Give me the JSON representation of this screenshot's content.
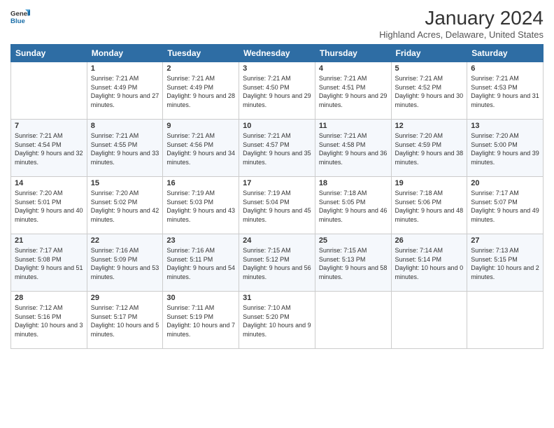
{
  "header": {
    "logo_line1": "General",
    "logo_line2": "Blue",
    "month_title": "January 2024",
    "location": "Highland Acres, Delaware, United States"
  },
  "weekdays": [
    "Sunday",
    "Monday",
    "Tuesday",
    "Wednesday",
    "Thursday",
    "Friday",
    "Saturday"
  ],
  "weeks": [
    [
      {
        "day": "",
        "sunrise": "",
        "sunset": "",
        "daylight": ""
      },
      {
        "day": "1",
        "sunrise": "Sunrise: 7:21 AM",
        "sunset": "Sunset: 4:49 PM",
        "daylight": "Daylight: 9 hours and 27 minutes."
      },
      {
        "day": "2",
        "sunrise": "Sunrise: 7:21 AM",
        "sunset": "Sunset: 4:49 PM",
        "daylight": "Daylight: 9 hours and 28 minutes."
      },
      {
        "day": "3",
        "sunrise": "Sunrise: 7:21 AM",
        "sunset": "Sunset: 4:50 PM",
        "daylight": "Daylight: 9 hours and 29 minutes."
      },
      {
        "day": "4",
        "sunrise": "Sunrise: 7:21 AM",
        "sunset": "Sunset: 4:51 PM",
        "daylight": "Daylight: 9 hours and 29 minutes."
      },
      {
        "day": "5",
        "sunrise": "Sunrise: 7:21 AM",
        "sunset": "Sunset: 4:52 PM",
        "daylight": "Daylight: 9 hours and 30 minutes."
      },
      {
        "day": "6",
        "sunrise": "Sunrise: 7:21 AM",
        "sunset": "Sunset: 4:53 PM",
        "daylight": "Daylight: 9 hours and 31 minutes."
      }
    ],
    [
      {
        "day": "7",
        "sunrise": "Sunrise: 7:21 AM",
        "sunset": "Sunset: 4:54 PM",
        "daylight": "Daylight: 9 hours and 32 minutes."
      },
      {
        "day": "8",
        "sunrise": "Sunrise: 7:21 AM",
        "sunset": "Sunset: 4:55 PM",
        "daylight": "Daylight: 9 hours and 33 minutes."
      },
      {
        "day": "9",
        "sunrise": "Sunrise: 7:21 AM",
        "sunset": "Sunset: 4:56 PM",
        "daylight": "Daylight: 9 hours and 34 minutes."
      },
      {
        "day": "10",
        "sunrise": "Sunrise: 7:21 AM",
        "sunset": "Sunset: 4:57 PM",
        "daylight": "Daylight: 9 hours and 35 minutes."
      },
      {
        "day": "11",
        "sunrise": "Sunrise: 7:21 AM",
        "sunset": "Sunset: 4:58 PM",
        "daylight": "Daylight: 9 hours and 36 minutes."
      },
      {
        "day": "12",
        "sunrise": "Sunrise: 7:20 AM",
        "sunset": "Sunset: 4:59 PM",
        "daylight": "Daylight: 9 hours and 38 minutes."
      },
      {
        "day": "13",
        "sunrise": "Sunrise: 7:20 AM",
        "sunset": "Sunset: 5:00 PM",
        "daylight": "Daylight: 9 hours and 39 minutes."
      }
    ],
    [
      {
        "day": "14",
        "sunrise": "Sunrise: 7:20 AM",
        "sunset": "Sunset: 5:01 PM",
        "daylight": "Daylight: 9 hours and 40 minutes."
      },
      {
        "day": "15",
        "sunrise": "Sunrise: 7:20 AM",
        "sunset": "Sunset: 5:02 PM",
        "daylight": "Daylight: 9 hours and 42 minutes."
      },
      {
        "day": "16",
        "sunrise": "Sunrise: 7:19 AM",
        "sunset": "Sunset: 5:03 PM",
        "daylight": "Daylight: 9 hours and 43 minutes."
      },
      {
        "day": "17",
        "sunrise": "Sunrise: 7:19 AM",
        "sunset": "Sunset: 5:04 PM",
        "daylight": "Daylight: 9 hours and 45 minutes."
      },
      {
        "day": "18",
        "sunrise": "Sunrise: 7:18 AM",
        "sunset": "Sunset: 5:05 PM",
        "daylight": "Daylight: 9 hours and 46 minutes."
      },
      {
        "day": "19",
        "sunrise": "Sunrise: 7:18 AM",
        "sunset": "Sunset: 5:06 PM",
        "daylight": "Daylight: 9 hours and 48 minutes."
      },
      {
        "day": "20",
        "sunrise": "Sunrise: 7:17 AM",
        "sunset": "Sunset: 5:07 PM",
        "daylight": "Daylight: 9 hours and 49 minutes."
      }
    ],
    [
      {
        "day": "21",
        "sunrise": "Sunrise: 7:17 AM",
        "sunset": "Sunset: 5:08 PM",
        "daylight": "Daylight: 9 hours and 51 minutes."
      },
      {
        "day": "22",
        "sunrise": "Sunrise: 7:16 AM",
        "sunset": "Sunset: 5:09 PM",
        "daylight": "Daylight: 9 hours and 53 minutes."
      },
      {
        "day": "23",
        "sunrise": "Sunrise: 7:16 AM",
        "sunset": "Sunset: 5:11 PM",
        "daylight": "Daylight: 9 hours and 54 minutes."
      },
      {
        "day": "24",
        "sunrise": "Sunrise: 7:15 AM",
        "sunset": "Sunset: 5:12 PM",
        "daylight": "Daylight: 9 hours and 56 minutes."
      },
      {
        "day": "25",
        "sunrise": "Sunrise: 7:15 AM",
        "sunset": "Sunset: 5:13 PM",
        "daylight": "Daylight: 9 hours and 58 minutes."
      },
      {
        "day": "26",
        "sunrise": "Sunrise: 7:14 AM",
        "sunset": "Sunset: 5:14 PM",
        "daylight": "Daylight: 10 hours and 0 minutes."
      },
      {
        "day": "27",
        "sunrise": "Sunrise: 7:13 AM",
        "sunset": "Sunset: 5:15 PM",
        "daylight": "Daylight: 10 hours and 2 minutes."
      }
    ],
    [
      {
        "day": "28",
        "sunrise": "Sunrise: 7:12 AM",
        "sunset": "Sunset: 5:16 PM",
        "daylight": "Daylight: 10 hours and 3 minutes."
      },
      {
        "day": "29",
        "sunrise": "Sunrise: 7:12 AM",
        "sunset": "Sunset: 5:17 PM",
        "daylight": "Daylight: 10 hours and 5 minutes."
      },
      {
        "day": "30",
        "sunrise": "Sunrise: 7:11 AM",
        "sunset": "Sunset: 5:19 PM",
        "daylight": "Daylight: 10 hours and 7 minutes."
      },
      {
        "day": "31",
        "sunrise": "Sunrise: 7:10 AM",
        "sunset": "Sunset: 5:20 PM",
        "daylight": "Daylight: 10 hours and 9 minutes."
      },
      {
        "day": "",
        "sunrise": "",
        "sunset": "",
        "daylight": ""
      },
      {
        "day": "",
        "sunrise": "",
        "sunset": "",
        "daylight": ""
      },
      {
        "day": "",
        "sunrise": "",
        "sunset": "",
        "daylight": ""
      }
    ]
  ]
}
